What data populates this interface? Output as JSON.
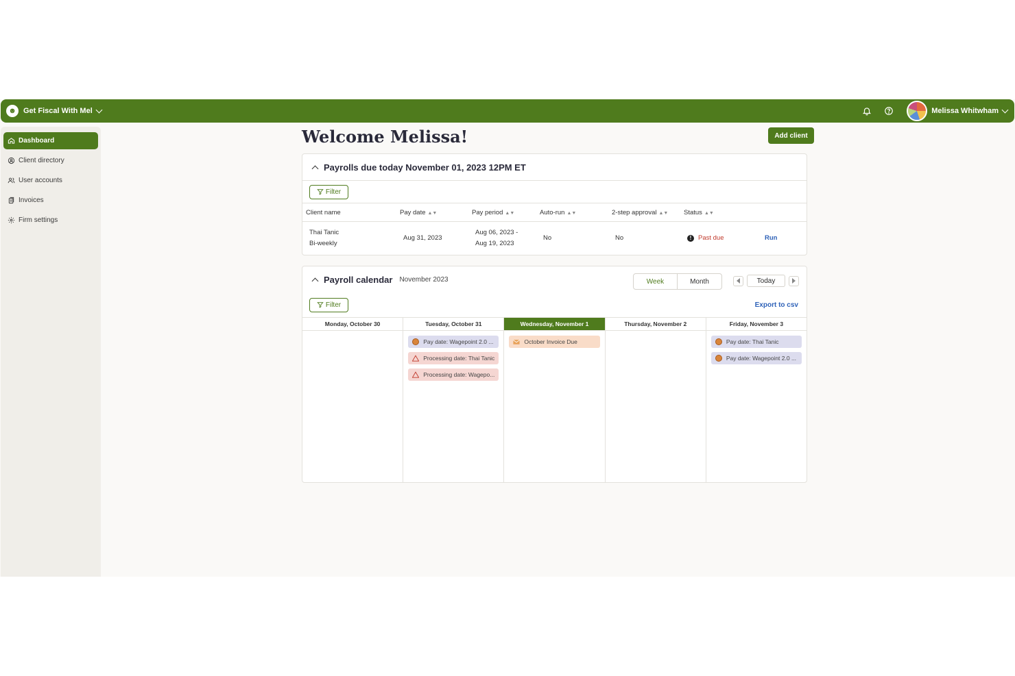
{
  "topbar": {
    "brand_name": "Get Fiscal With Mel",
    "user_name": "Melissa Whitwham"
  },
  "sidebar": {
    "items": [
      {
        "label": "Dashboard",
        "icon": "home-icon",
        "active": true
      },
      {
        "label": "Client directory",
        "icon": "user-circle-icon",
        "active": false
      },
      {
        "label": "User accounts",
        "icon": "users-icon",
        "active": false
      },
      {
        "label": "Invoices",
        "icon": "invoice-icon",
        "active": false
      },
      {
        "label": "Firm settings",
        "icon": "gear-icon",
        "active": false
      }
    ]
  },
  "main": {
    "welcome": "Welcome Melissa!",
    "add_client_label": "Add client"
  },
  "payrolls": {
    "title": "Payrolls due today November 01, 2023 12PM ET",
    "filter_label": "Filter",
    "columns": [
      "Client name",
      "Pay date",
      "Pay period",
      "Auto-run",
      "2-step approval",
      "Status"
    ],
    "rows": [
      {
        "client": "Thai Tanic",
        "frequency": "Bi-weekly",
        "pay_date": "Aug 31, 2023",
        "period_start": "Aug 06, 2023 -",
        "period_end": "Aug 19, 2023",
        "auto_run": "No",
        "two_step": "No",
        "status": "Past due",
        "action": "Run"
      }
    ]
  },
  "calendar": {
    "title": "Payroll calendar",
    "month": "November 2023",
    "view_week": "Week",
    "view_month": "Month",
    "today_label": "Today",
    "filter_label": "Filter",
    "export_label": "Export to csv",
    "days": [
      {
        "label": "Monday, October 30",
        "current": false,
        "events": []
      },
      {
        "label": "Tuesday, October 31",
        "current": false,
        "events": [
          {
            "type": "pay",
            "text": "Pay date: Wagepoint 2.0 ..."
          },
          {
            "type": "proc",
            "text": "Processing date: Thai Tanic"
          },
          {
            "type": "proc",
            "text": "Processing date: Wagepo..."
          }
        ]
      },
      {
        "label": "Wednesday, November 1",
        "current": true,
        "events": [
          {
            "type": "invoice",
            "text": "October Invoice Due"
          }
        ]
      },
      {
        "label": "Thursday, November 2",
        "current": false,
        "events": []
      },
      {
        "label": "Friday, November 3",
        "current": false,
        "events": [
          {
            "type": "pay",
            "text": "Pay date: Thai Tanic"
          },
          {
            "type": "pay",
            "text": "Pay date: Wagepoint 2.0 ..."
          }
        ]
      }
    ]
  },
  "colors": {
    "brand_green": "#4f7b1d",
    "link_blue": "#2f62b8",
    "past_due_red": "#c0392b"
  }
}
